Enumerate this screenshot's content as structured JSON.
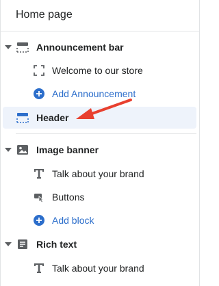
{
  "panel": {
    "title": "Home page"
  },
  "sections": {
    "announcement_bar": {
      "label": "Announcement bar",
      "icon": "announcement-bar-icon",
      "blocks": [
        {
          "label": "Welcome to our store",
          "icon": "dashed-square-icon"
        }
      ],
      "add_label": "Add Announcement"
    },
    "header": {
      "label": "Header",
      "icon": "header-layout-icon"
    },
    "image_banner": {
      "label": "Image banner",
      "icon": "image-icon",
      "blocks": [
        {
          "label": "Talk about your brand",
          "icon": "text-T-icon"
        },
        {
          "label": "Buttons",
          "icon": "button-cursor-icon"
        }
      ],
      "add_label": "Add block"
    },
    "rich_text": {
      "label": "Rich text",
      "icon": "text-lines-icon",
      "blocks": [
        {
          "label": "Talk about your brand",
          "icon": "text-T-icon"
        }
      ]
    }
  },
  "colors": {
    "accent": "#2c6ecb",
    "annotation_arrow": "#e8402f",
    "selected_bg": "#eef3fb"
  }
}
